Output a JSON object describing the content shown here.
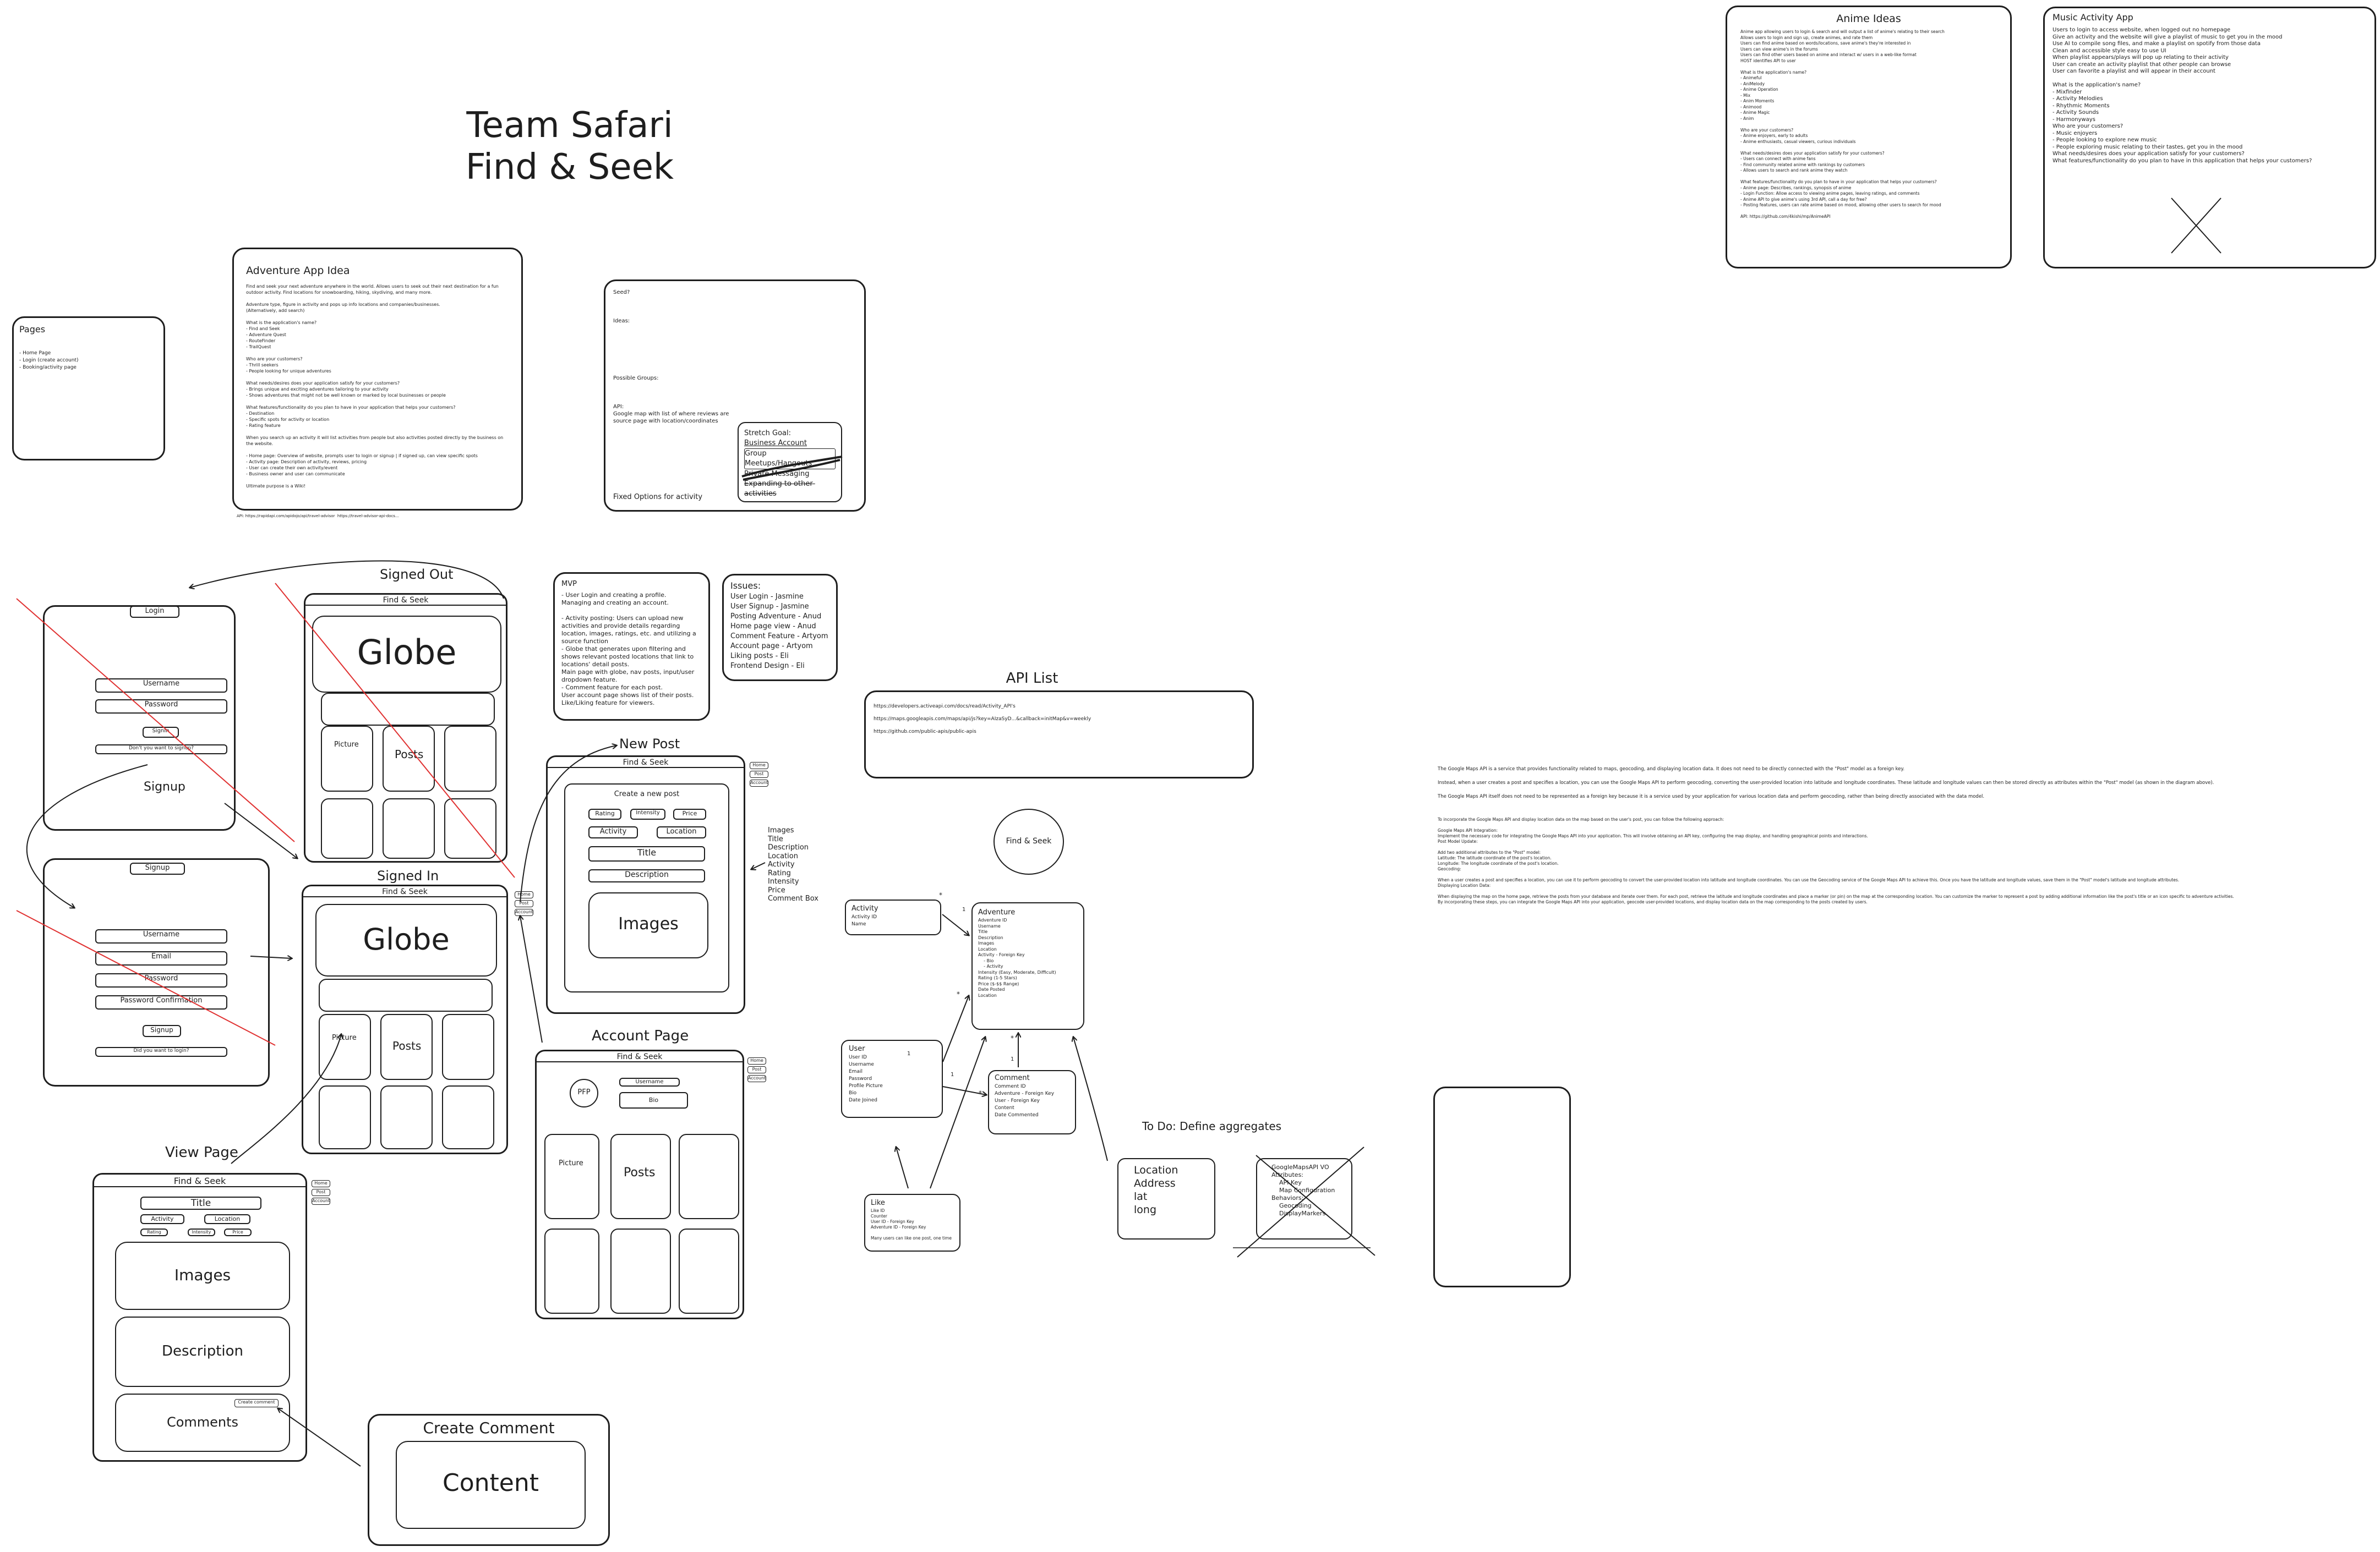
{
  "header": {
    "line1": "Team Safari",
    "line2": "Find & Seek"
  },
  "pages_note": {
    "title": "Pages",
    "lines": "- Home Page\n- Login (create account)\n- Booking/activity page"
  },
  "adventure_idea": {
    "title": "Adventure App Idea",
    "body": "Find and seek your next adventure anywhere in the world. Allows users to seek out their next destination for a fun outdoor activity. Find locations for snowboarding, hiking, skydiving, and many more.\n\nAdventure type, figure in activity and pops up info locations and companies/businesses.\n(Alternatively, add search)\n\nWhat is the application's name?\n- Find and Seek\n- Adventure Quest\n- RouteFinder\n- TrailQuest\n\nWho are your customers?\n- Thrill seekers\n- People looking for unique adventures\n\nWhat needs/desires does your application satisfy for your customers?\n- Brings unique and exciting adventures tailoring to your activity\n- Shows adventures that might not be well known or marked by local businesses or people\n\nWhat features/functionality do you plan to have in your application that helps your customers?\n- Destination\n- Specific spots for activity or location\n- Rating feature\n\nWhen you search up an activity it will list activities from people but also activities posted directly by the business on the website.\n\n- Home page: Overview of website, prompts user to login or signup | if signed up, can view specific spots\n- Activity page: Description of activity, reviews, pricing\n- User can create their own activity/event\n- Business owner and user can communicate\n\nUltimate purpose is a Wiki!",
    "footer": "API: https://rapidapi.com/apidojo/api/travel-advisor  https://travel-advisor-api-docs..."
  },
  "notes_box": {
    "lines": "Seed?\n\n\n\nIdeas:\n\n\n\n\n\n\n\nPossible Groups:\n\n\n\nAPI:\nGoogle map with list of where reviews are\nsource page with location/coordinates",
    "footer": "Fixed Options for activity",
    "stretch_title": "Stretch Goal:",
    "stretch_items": [
      "Business Account",
      "Group Meetups/Hangouts",
      "Private Messaging",
      "Expanding to other activities"
    ]
  },
  "mvp": {
    "title": "MVP",
    "body": "- User Login and creating a profile.\nManaging and creating an account.\n\n- Activity posting: Users can upload new activities and provide details regarding location, images, ratings, etc. and utilizing a source function\n- Globe that generates upon filtering and shows relevant posted locations that link to locations' detail posts.\nMain page with globe, nav posts, input/user dropdown feature.\n- Comment feature for each post.\nUser account page shows list of their posts.\nLike/Liking feature for viewers."
  },
  "issues": {
    "title": "Issues:",
    "items": [
      "User Login - Jasmine",
      "User Signup - Jasmine",
      "Posting Adventure - Anud",
      "Home page view - Anud",
      "Comment Feature - Artyom",
      "Account page - Artyom",
      "Liking posts - Eli",
      "Frontend Design - Eli"
    ]
  },
  "api_list": {
    "title": "API List",
    "links": [
      "https://developers.activeapi.com/docs/read/Activity_API's",
      "https://maps.googleapis.com/maps/api/js?key=AIzaSyD...&callback=initMap&v=weekly",
      "https://github.com/public-apis/public-apis"
    ]
  },
  "anime": {
    "title": "Anime Ideas",
    "body": "Anime app allowing users to login & search and will output a list of anime's relating to their search\nAllows users to login and sign up, create animes, and rate them\nUsers can find anime based on words/locations, save anime's they're interested in\nUsers can view anime's in the forums\nUsers can find other users based on anime and interact w/ users in a web-like format\nHOST identifies API to user\n\nWhat is the application's name?\n- Animeful\n- AniMelody\n- Anime Operation\n- Mix\n- Anim Moments\n- Animood\n- Anime Magic\n- Anim\n\nWho are your customers?\n- Anime enjoyers, early to adults\n- Anime enthusiasts, casual viewers, curious individuals\n\nWhat needs/desires does your application satisfy for your customers?\n- Users can connect with anime fans\n- Find community related anime with rankings by customers\n- Allows users to search and rank anime they watch\n\nWhat features/functionality do you plan to have in your application that helps your customers?\n- Anime page: Describes, rankings, synopsis of anime\n- Login Function: Allow access to viewing anime pages, leaving ratings, and comments\n- Anime API to give anime's using 3rd API, call a day for free?\n- Posting features, users can rate anime based on mood, allowing other users to search for mood\n\nAPI: https://github.com/4kishi/mp/AnimeAPI",
    "footer": "API: https://github.com/Anime/AnimeAPI/docs"
  },
  "music": {
    "title": "Music Activity App",
    "body": "Users to login to access website, when logged out no homepage\nGive an activity and the website will give a playlist of music to get you in the mood\nUse AI to compile song files, and make a playlist on spotify from those data\nClean and accessible style easy to use UI\nWhen playlist appears/plays will pop up relating to their activity\nUser can create an activity playlist that other people can browse\nUser can favorite a playlist and will appear in their account\n\nWhat is the application's name?\n- Mixfinder\n- Activity Melodies\n- Rhythmic Moments\n- Activity Sounds\n- Harmonyways\nWho are your customers?\n- Music enjoyers\n- People looking to explore new music\n- People exploring music relating to their tastes, get you in the mood\nWhat needs/desires does your application satisfy for your customers?\nWhat features/functionality do you plan to have in this application that helps your customers?"
  },
  "maps_notes": {
    "p1": "The Google Maps API is a service that provides functionality related to maps, geocoding, and displaying location data. It does not need to be directly connected with the \"Post\" model as a foreign key.",
    "p2": "Instead, when a user creates a post and specifies a location, you can use the Google Maps API to perform geocoding, converting the user-provided location into latitude and longitude coordinates. These latitude and longitude values can then be stored directly as attributes within the \"Post\" model (as shown in the diagram above).",
    "p3": "The Google Maps API itself does not need to be represented as a foreign key because it is a service used by your application for various location data and perform geocoding, rather than being directly associated with the data model.",
    "p4": "To incorporate the Google Maps API and display location data on the map based on the user's post, you can follow the following approach:\n\nGoogle Maps API Integration:\nImplement the necessary code for integrating the Google Maps API into your application. This will involve obtaining an API key, configuring the map display, and handling geographical points and interactions.\nPost Model Update:\n\nAdd two additional attributes to the \"Post\" model:\nLatitude: The latitude coordinate of the post's location.\nLongitude: The longitude coordinate of the post's location.\nGeocoding:\n\nWhen a user creates a post and specifies a location, you can use it to perform geocoding to convert the user-provided location into latitude and longitude coordinates. You can use the Geocoding service of the Google Maps API to achieve this. Once you have the latitude and longitude values, save them in the \"Post\" model's latitude and longitude attributes.\nDisplaying Location Data:\n\nWhen displaying the map on the home page, retrieve the posts from your database and iterate over them. For each post, retrieve the latitude and longitude coordinates and place a marker (or pin) on the map at the corresponding location. You can customize the marker to represent a post by adding additional information like the post's title or an icon specific to adventure activities.\nBy incorporating these steps, you can integrate the Google Maps API into your application, geocode user-provided locations, and display location data on the map corresponding to the posts created by users."
  },
  "wireframes": {
    "signed_out": "Signed Out",
    "signed_in": "Signed In",
    "new_post": "New Post",
    "account_page": "Account Page",
    "view_page": "View Page",
    "create_comment": "Create Comment",
    "app_name": "Find & Seek",
    "globe": "Globe",
    "posts": "Posts",
    "picture": "Picture",
    "login_title": "Login",
    "signup_title": "Signup",
    "username": "Username",
    "password": "Password",
    "email": "Email",
    "password_confirmation": "Password Confirmation",
    "signin_btn": "SignIn",
    "signup_btn": "Signup",
    "no_account": "Don't you want to signup?",
    "have_account": "Did you want to login?",
    "signup_word": "Signup",
    "filter_rating": "Rating",
    "filter_intensity": "Intensity",
    "filter_price": "Price",
    "filter_activity": "Activity",
    "filter_location": "Location",
    "create_new_post": "Create a new post",
    "title": "Title",
    "description": "Description",
    "images": "Images",
    "comments": "Comments",
    "content": "Content",
    "pfp": "PFP",
    "bio": "Bio",
    "new_post_fields": [
      "Images",
      "Title",
      "Description",
      "Location",
      "Activity",
      "Rating",
      "Intensity",
      "Price",
      "Comment Box"
    ],
    "nav_labels": [
      "Home",
      "Post",
      "Account"
    ],
    "create_comment_btn": "Create comment"
  },
  "erd": {
    "site_title": "Find & Seek",
    "activity": {
      "title": "Activity",
      "fields": "Activity ID\nName"
    },
    "adventure": {
      "title": "Adventure",
      "fields": "Adventure ID\nUsername\nTitle\nDescription\nImages\nLocation\nActivity - Foreign Key\n    - Bio\n    - Activity\nIntensity (Easy, Moderate, Difficult)\nRating (1-5 Stars)\nPrice ($-$$ Range)\nDate Posted\nLocation"
    },
    "user": {
      "title": "User",
      "fields": "User ID\nUsername\nEmail\nPassword\nProfile Picture\nBio\nDate Joined"
    },
    "comment": {
      "title": "Comment",
      "fields": "Comment ID\nAdventure - Foreign Key\nUser - Foreign Key\nContent\nDate Commented"
    },
    "like": {
      "title": "Like",
      "fields": "Like ID\nCounter\nUser ID - Foreign Key\nAdventure ID - Foreign Key\n\nMany users can like one post, one time"
    },
    "todo": "To Do: Define aggregates",
    "location": {
      "lines": "Location\nAddress\nlat\nlong"
    },
    "gmaps": {
      "lines": "GoogleMapsAPI VO\nAttributes:\n    API Key\n    Map Configuration\nBehaviors:\n    Geocoding\n    DisplayMarkers"
    },
    "card_labels": {
      "one": "1",
      "many": "*"
    }
  }
}
